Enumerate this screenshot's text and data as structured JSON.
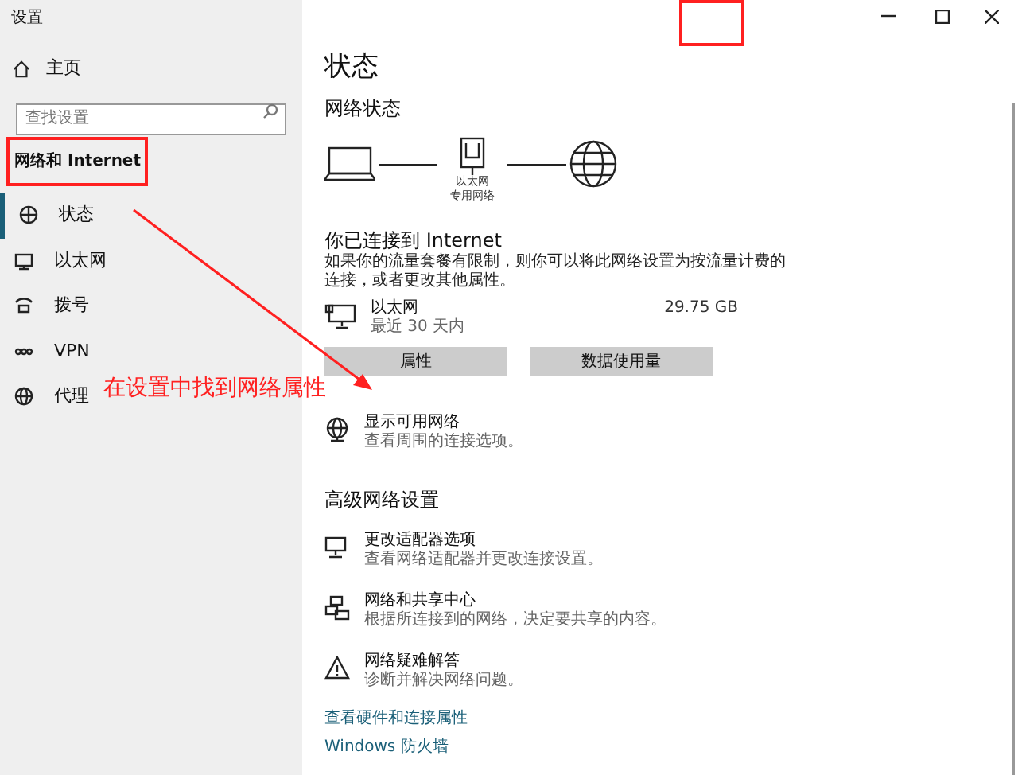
{
  "window": {
    "title": "设置"
  },
  "sidebar": {
    "home": "主页",
    "search": {
      "placeholder": "查找设置"
    },
    "section": "网络和 Internet",
    "items": [
      {
        "label": "状态",
        "kind": "status",
        "selected": true
      },
      {
        "label": "以太网",
        "kind": "ethernet",
        "selected": false
      },
      {
        "label": "拨号",
        "kind": "dialup",
        "selected": false
      },
      {
        "label": "VPN",
        "kind": "vpn",
        "selected": false
      },
      {
        "label": "代理",
        "kind": "proxy",
        "selected": false
      }
    ]
  },
  "main": {
    "title": "状态",
    "network_status": "网络状态",
    "diagram": {
      "adapter": "以太网",
      "profile": "专用网络"
    },
    "connected_heading": "你已连接到 Internet",
    "connected_desc": "如果你的流量套餐有限制，则你可以将此网络设置为按流量计费的连接，或者更改其他属性。",
    "connection": {
      "name": "以太网",
      "period": "最近 30 天内",
      "usage": "29.75 GB"
    },
    "buttons": [
      "属性",
      "数据使用量"
    ],
    "show_networks": {
      "title": "显示可用网络",
      "desc": "查看周围的连接选项。"
    },
    "advanced_heading": "高级网络设置",
    "advanced_items": [
      {
        "kind": "adapter",
        "title": "更改适配器选项",
        "desc": "查看网络适配器并更改连接设置。"
      },
      {
        "kind": "sharing",
        "title": "网络和共享中心",
        "desc": "根据所连接到的网络，决定要共享的内容。"
      },
      {
        "kind": "troubleshoot",
        "title": "网络疑难解答",
        "desc": "诊断并解决网络问题。"
      }
    ],
    "links": [
      "查看硬件和连接属性",
      "Windows 防火墙"
    ]
  },
  "annotation": {
    "text": "在设置中找到网络属性"
  }
}
